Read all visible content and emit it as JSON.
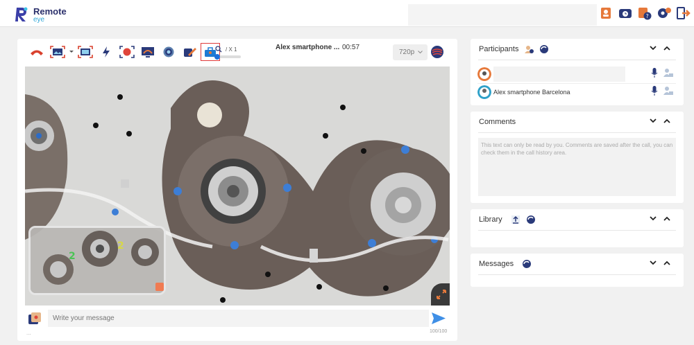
{
  "app": {
    "brand": "Remote",
    "brand_sub": "eye"
  },
  "header": {
    "icons": [
      "contacts-icon",
      "history-icon",
      "help-icon",
      "settings-icon",
      "logout-icon"
    ]
  },
  "call": {
    "title": "Alex smartphone ...",
    "duration": "00:57",
    "zoom_label": "/ X 1",
    "resolution": "720p",
    "toolbar": [
      "hang-up-icon",
      "capture-image-icon",
      "capture-dropdown-icon",
      "screen-share-icon",
      "flash-icon",
      "record-icon",
      "screen-cast-icon",
      "camera-switch-icon",
      "annotate-icon",
      "toolbox-icon"
    ],
    "message_placeholder": "Write your message",
    "dots": "...",
    "counter": "100/100",
    "pip_numbers": [
      "2",
      "2"
    ]
  },
  "participants": {
    "title": "Participants",
    "rows": [
      {
        "name": ""
      },
      {
        "name": "Alex smartphone Barcelona"
      }
    ]
  },
  "comments": {
    "title": "Comments",
    "placeholder": "This text can only be read by you. Comments are saved after the call, you can check them in the call history area."
  },
  "library": {
    "title": "Library"
  },
  "messages": {
    "title": "Messages"
  },
  "colors": {
    "accent": "#1e6fd9",
    "brand_dark": "#2a2f6b",
    "brand_light": "#31a7d8",
    "hangup": "#d9412e",
    "selected_border": "#e03a3a"
  }
}
